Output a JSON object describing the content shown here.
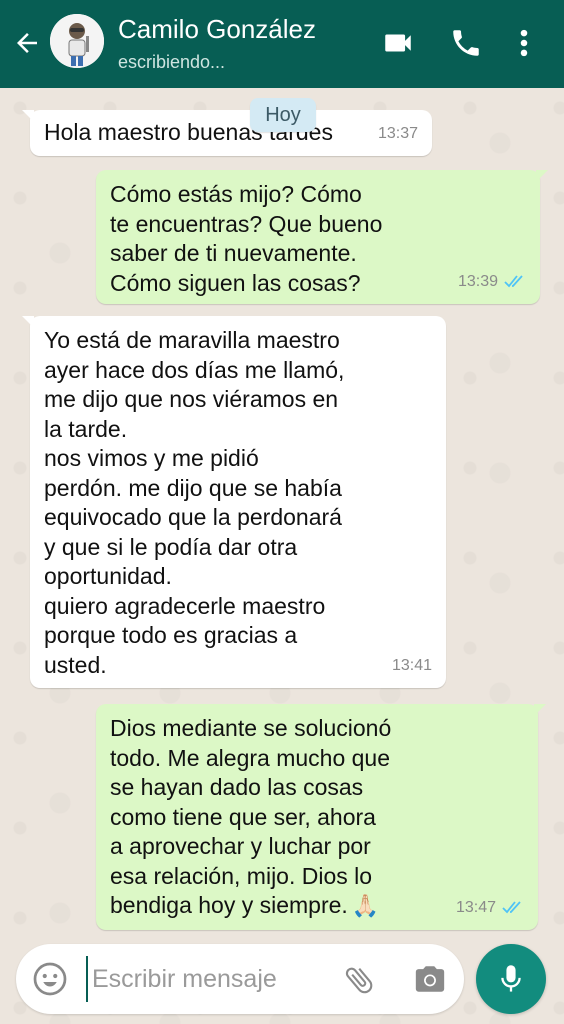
{
  "header": {
    "contact_name": "Camilo González",
    "status": "escribiendo..."
  },
  "date_chip": "Hoy",
  "messages": [
    {
      "direction": "incoming",
      "text": "Hola maestro buenas tardes",
      "time": "13:37"
    },
    {
      "direction": "outgoing",
      "text": "Cómo estás mijo? Cómo\nte encuentras? Que bueno\nsaber de ti nuevamente.\nCómo siguen las cosas?",
      "time": "13:39",
      "read": true
    },
    {
      "direction": "incoming",
      "text": "Yo está de maravilla maestro\nayer hace dos días me llamó,\nme dijo que nos viéramos en\nla tarde.\nnos vimos y me pidió\nperdón. me dijo que se había\nequivocado que la perdonará\ny que si le podía dar otra\noportunidad.\nquiero agradecerle maestro\nporque todo es gracias a\nusted.",
      "time": "13:41"
    },
    {
      "direction": "outgoing",
      "text": "Dios mediante se solucionó\ntodo. Me alegra mucho que\nse hayan dado las cosas\ncomo tiene que ser, ahora\na aprovechar y luchar por\nesa relación, mijo. Dios lo\nbendiga hoy y siempre.",
      "emoji": "🙏🏻",
      "time": "13:47",
      "read": true
    }
  ],
  "input": {
    "placeholder": "Escribir mensaje"
  },
  "icons": {
    "back": "arrow-back-icon",
    "video": "video-call-icon",
    "call": "phone-icon",
    "more": "more-vert-icon",
    "emoji": "emoji-icon",
    "attach": "paperclip-icon",
    "camera": "camera-icon",
    "mic": "mic-icon"
  },
  "colors": {
    "header": "#075e54",
    "outgoing_bubble": "#dcf8c6",
    "incoming_bubble": "#ffffff",
    "read_ticks": "#4fc3f7",
    "mic_button": "#128c7e"
  }
}
